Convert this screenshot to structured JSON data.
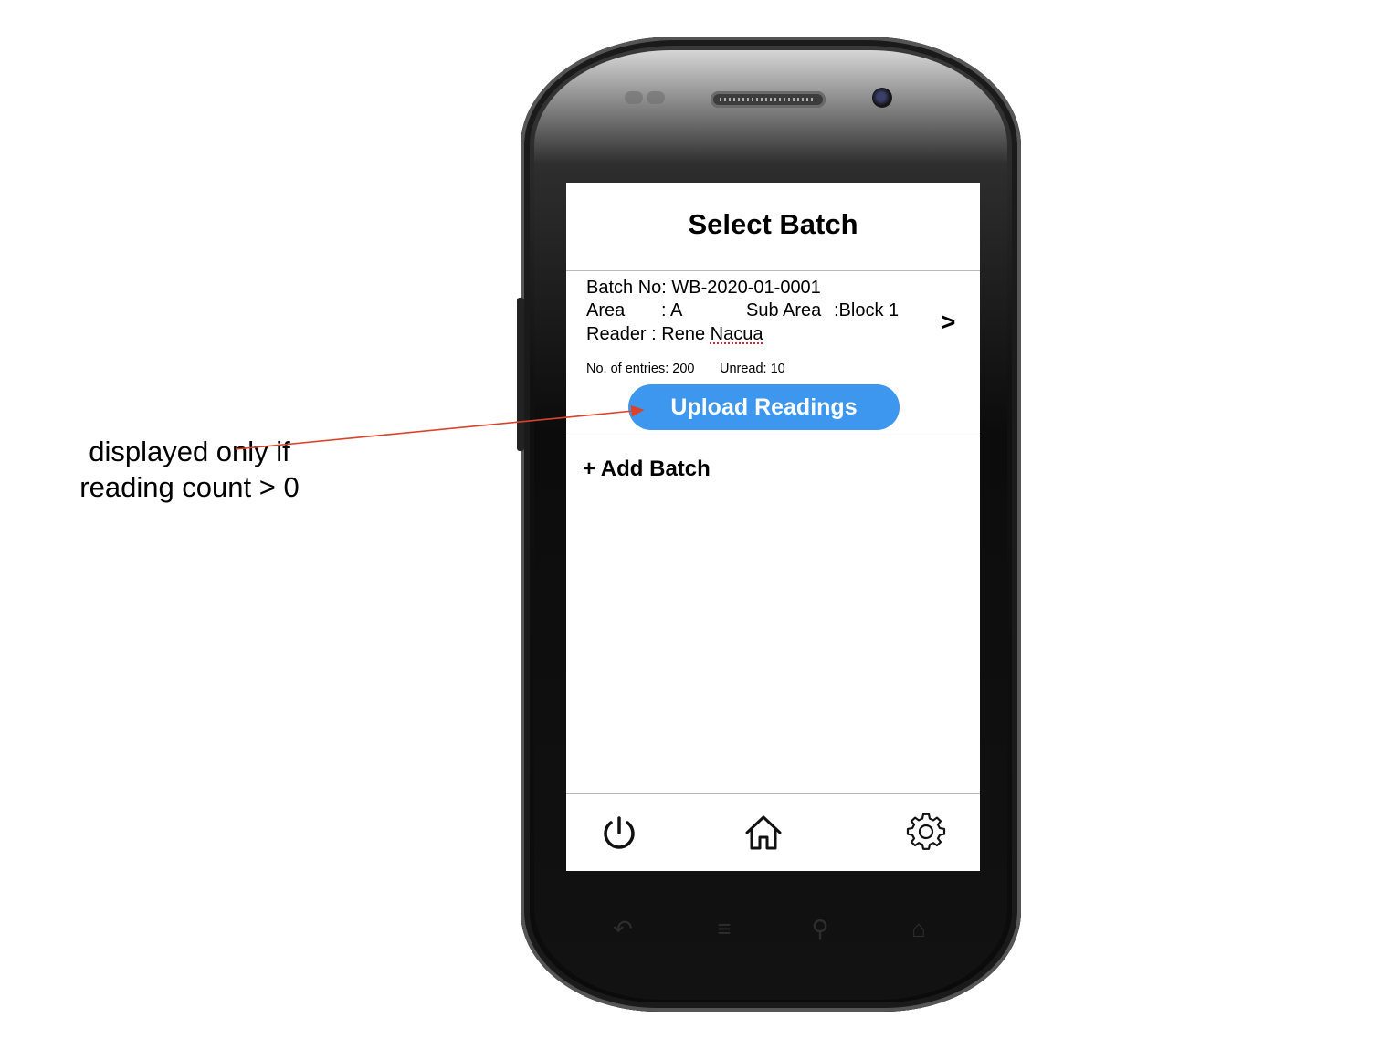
{
  "screen": {
    "title": "Select Batch"
  },
  "batch": {
    "batch_no": "Batch No: WB-2020-01-0001",
    "area_label": "Area",
    "area_value": ": A",
    "sub_area_label": "Sub Area",
    "sub_area_value": ":Block 1",
    "reader_label": "Reader : ",
    "reader_name_first": "Rene ",
    "reader_name_last": "Nacua",
    "entries": "No. of entries: 200",
    "unread": "Unread: 10",
    "open_chevron": ">",
    "upload_button_label": "Upload Readings"
  },
  "add_batch_label": "+ Add Batch",
  "bottom_nav": {
    "items": [
      {
        "icon": "power-icon"
      },
      {
        "icon": "home-icon"
      },
      {
        "icon": "gear-icon"
      }
    ]
  },
  "annotation": {
    "line1": "displayed only if",
    "line2": "reading count > 0",
    "arrow_color": "#d9432c"
  },
  "colors": {
    "accent": "#3d97ee",
    "divider": "#b9b9b9"
  }
}
